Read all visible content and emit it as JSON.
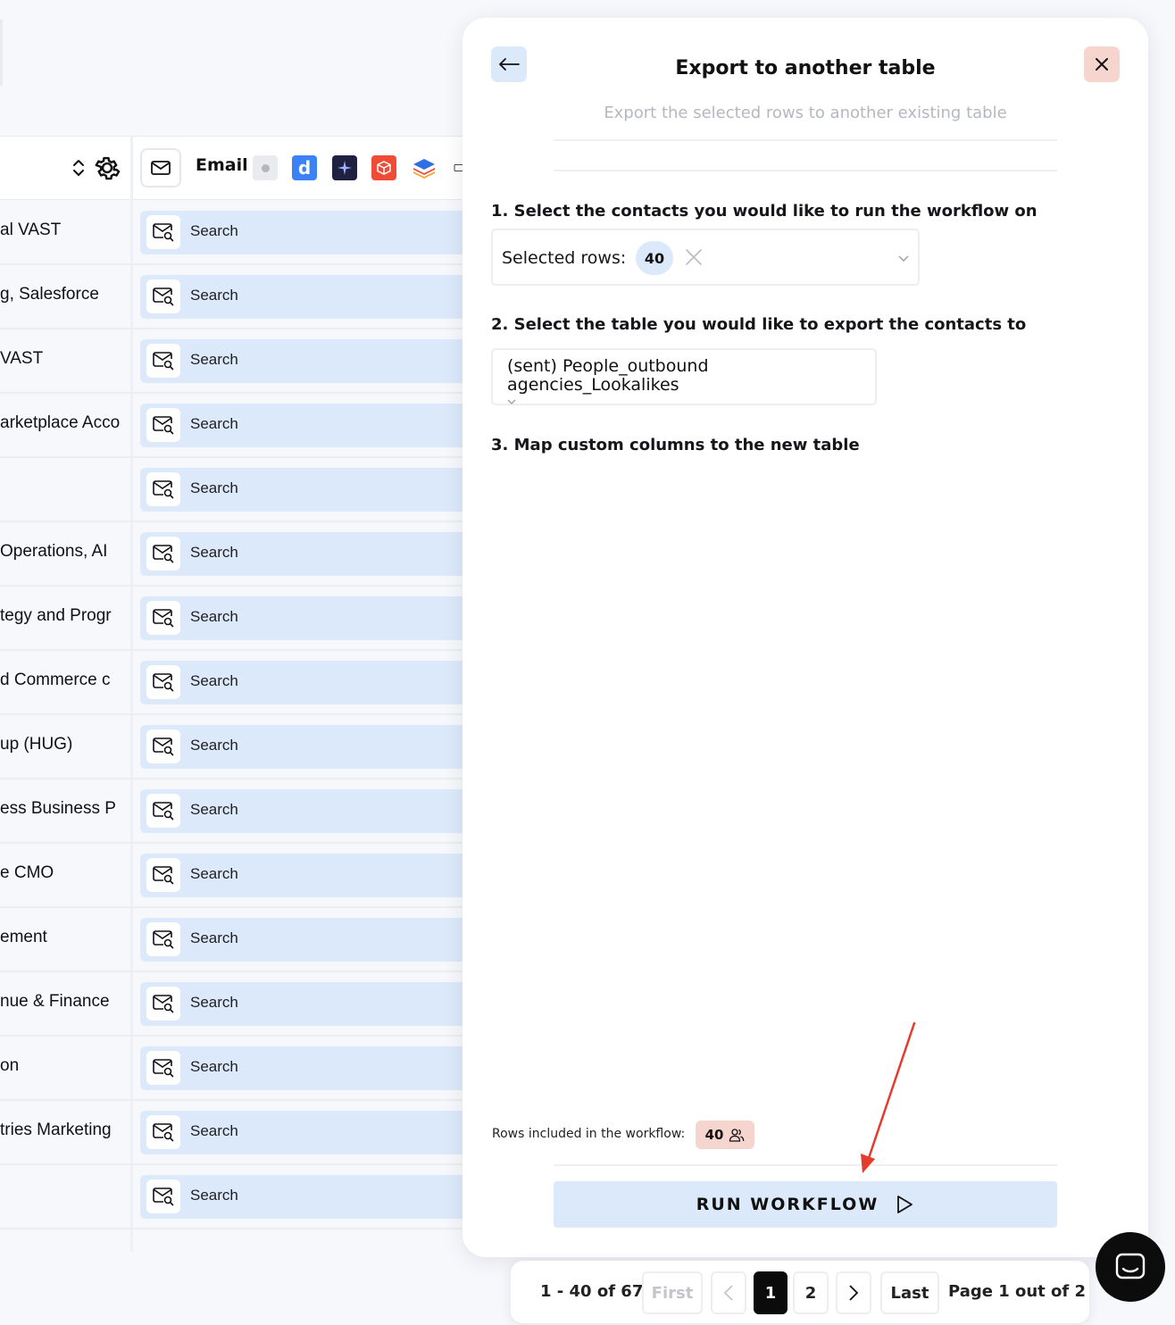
{
  "table": {
    "email_column_label": "Email",
    "search_label": "Search",
    "rows": [
      {
        "text": "al VAST"
      },
      {
        "text": "g, Salesforce"
      },
      {
        "text": "VAST"
      },
      {
        "text": "arketplace Acco"
      },
      {
        "text": ""
      },
      {
        "text": " Operations, AI"
      },
      {
        "text": "tegy and Progr"
      },
      {
        "text": "d Commerce c"
      },
      {
        "text": "up (HUG)"
      },
      {
        "text": "ess Business P"
      },
      {
        "text": "e CMO"
      },
      {
        "text": "ement"
      },
      {
        "text": "nue & Finance"
      },
      {
        "text": "on"
      },
      {
        "text": "tries Marketing"
      },
      {
        "text": ""
      }
    ]
  },
  "modal": {
    "title": "Export to another table",
    "subtitle": "Export the selected rows to another existing table",
    "step1_label": "1. Select the contacts you would like to run the workflow on",
    "selected_rows_label": "Selected rows:",
    "selected_rows_count": "40",
    "step2_label": "2. Select the table you would like to export the contacts to",
    "selected_table": "(sent) People_outbound agencies_Lookalikes",
    "step3_label": "3. Map custom columns to the new table",
    "rows_included_label": "Rows included in the workflow:",
    "rows_included_count": "40",
    "run_button_label": "RUN WORKFLOW"
  },
  "pagination": {
    "range": "1 - 40 of 67",
    "first_label": "First",
    "page1": "1",
    "page2": "2",
    "last_label": "Last",
    "status": "Page 1 out of 2"
  },
  "colors": {
    "accent_light_blue": "#dce9fa",
    "danger_light": "#f7d5cf",
    "arrow_red": "#e53a2c"
  }
}
